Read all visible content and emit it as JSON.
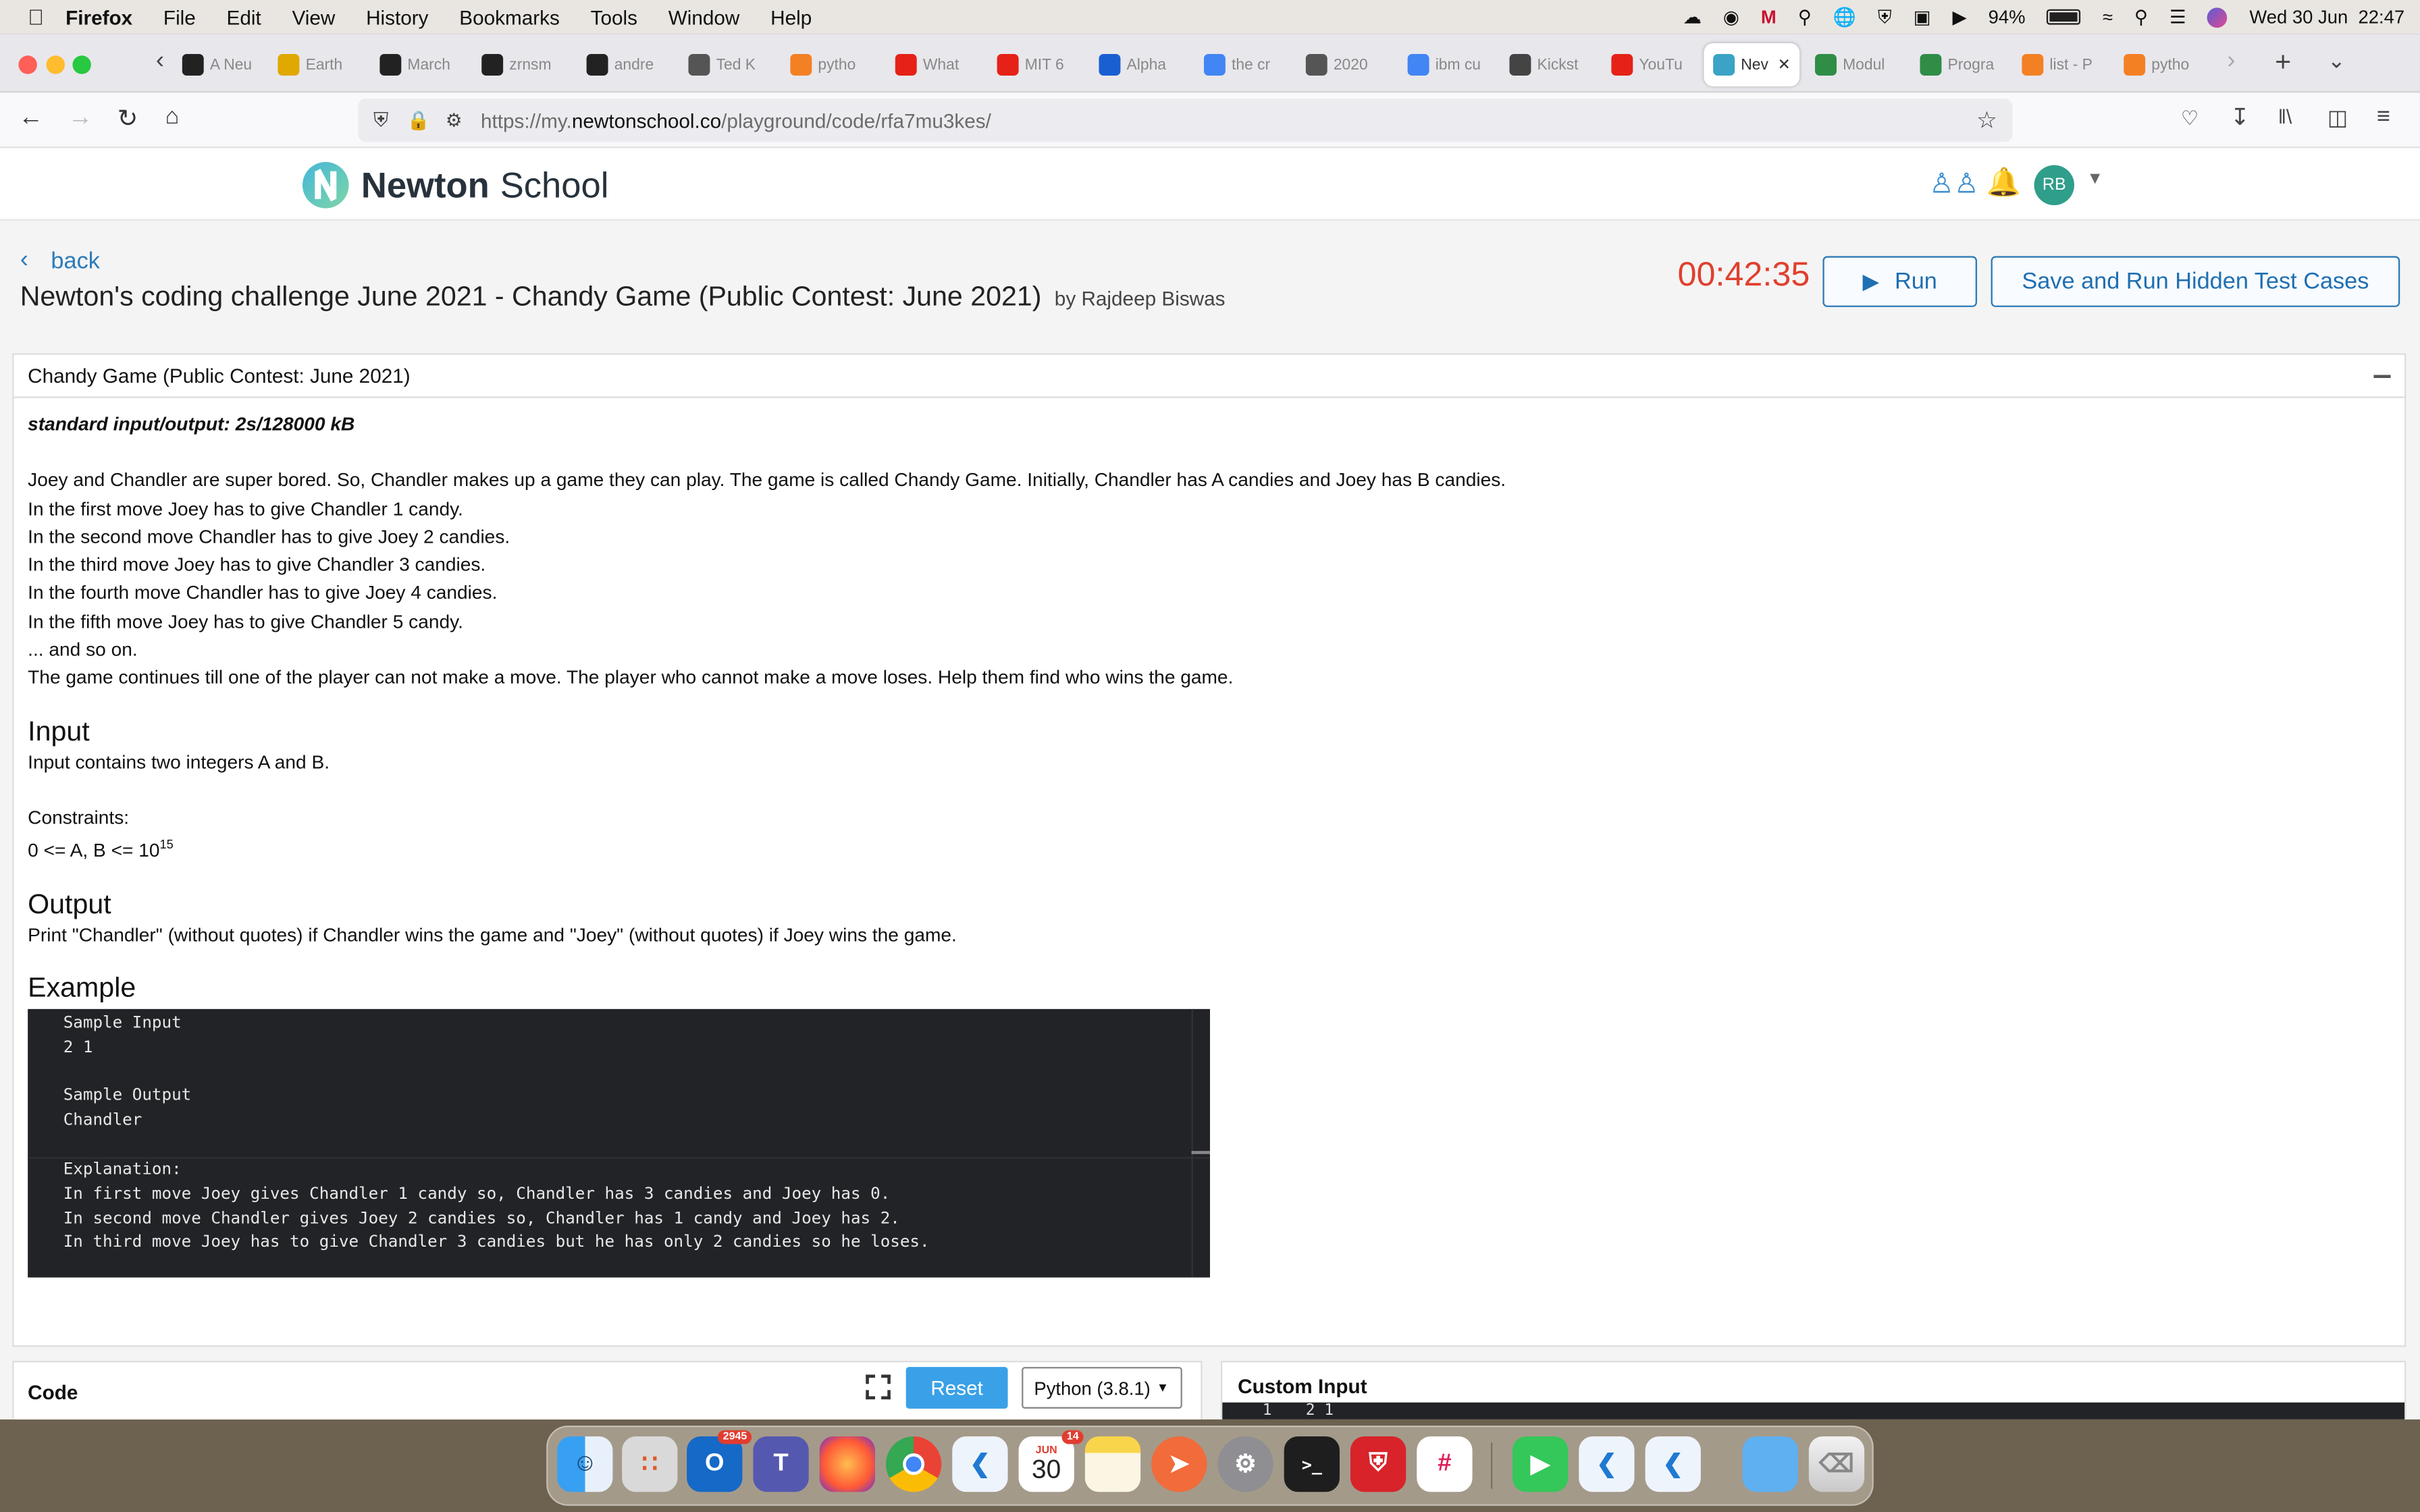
{
  "menubar": {
    "app": "Firefox",
    "items": [
      "File",
      "Edit",
      "View",
      "History",
      "Bookmarks",
      "Tools",
      "Window",
      "Help"
    ],
    "battery": "94%",
    "datetime": "Wed 30 Jun  22:47"
  },
  "tabs": [
    {
      "label": "A Neu",
      "color": "#222"
    },
    {
      "label": "Earth",
      "color": "#e0a800"
    },
    {
      "label": "March",
      "color": "#222"
    },
    {
      "label": "zrnsm",
      "color": "#222"
    },
    {
      "label": "andre",
      "color": "#222"
    },
    {
      "label": "Ted K",
      "color": "#555"
    },
    {
      "label": "pytho",
      "color": "#f48024"
    },
    {
      "label": "What",
      "color": "#e62117"
    },
    {
      "label": "MIT 6",
      "color": "#e62117"
    },
    {
      "label": "Alpha",
      "color": "#1a5fd1"
    },
    {
      "label": "the cr",
      "color": "#4285f4"
    },
    {
      "label": "2020",
      "color": "#555"
    },
    {
      "label": "ibm cu",
      "color": "#4285f4"
    },
    {
      "label": "Kickst",
      "color": "#444"
    },
    {
      "label": "YouTu",
      "color": "#e62117"
    },
    {
      "label": "Nev",
      "color": "#3ba3c5"
    },
    {
      "label": "Modul",
      "color": "#2f8d46"
    },
    {
      "label": "Progra",
      "color": "#2f8d46"
    },
    {
      "label": "list - P",
      "color": "#f48024"
    },
    {
      "label": "pytho",
      "color": "#f48024"
    }
  ],
  "url": {
    "prefix": "https://my.",
    "domain": "newtonschool.co",
    "path": "/playground/code/rfa7mu3kes/"
  },
  "site": {
    "brand_bold": "Newton",
    "brand_light": "School",
    "avatar": "RB"
  },
  "problem_header": {
    "back": "back",
    "title": "Newton's coding challenge June 2021 - Chandy Game (Public Contest: June 2021)",
    "by": "by Rajdeep Biswas",
    "timer": "00:42:35",
    "run": "Run",
    "save_run": "Save and Run Hidden Test Cases"
  },
  "panel": {
    "title": "Chandy Game (Public Contest: June 2021)",
    "io": "standard input/output: 2s/128000 kB",
    "statement": [
      "Joey and Chandler are super bored. So, Chandler makes up a game they can play. The game is called Chandy Game. Initially, Chandler has A candies and Joey has B candies.",
      "In the first move Joey has to give Chandler 1 candy.",
      "In the second move Chandler has to give Joey 2 candies.",
      "In the third move Joey has to give Chandler 3 candies.",
      "In the fourth move Chandler has to give Joey 4 candies.",
      "In the fifth move Joey has to give Chandler 5 candy.",
      "... and so on.",
      "The game continues till one of the player can not make a move. The player who cannot make a move loses. Help them find who wins the game."
    ],
    "input_heading": "Input",
    "input_text": "Input contains two integers A and B.",
    "constraints_label": "Constraints:",
    "constraints": "0 <= A, B <= 10",
    "constraints_exp": "15",
    "output_heading": "Output",
    "output_text": "Print \"Chandler\" (without quotes) if Chandler wins the game and \"Joey\" (without quotes) if Joey wins the game.",
    "example_heading": "Example",
    "example_lines": [
      "Sample Input",
      "2 1",
      "",
      "Sample Output",
      "Chandler",
      "",
      "Explanation:",
      "In first move Joey gives Chandler 1 candy so, Chandler has 3 candies and Joey has 0.",
      "In second move Chandler gives Joey 2 candies so, Chandler has 1 candy and Joey has 2.",
      "In third move Joey has to give Chandler 3 candies but he has only 2 candies so he loses."
    ]
  },
  "code_panel": {
    "title": "Code",
    "reset": "Reset",
    "language": "Python (3.8.1)"
  },
  "custom_panel": {
    "title": "Custom Input",
    "line_no": "1",
    "line": "2 1"
  },
  "dock": {
    "outlook_badge": "2945",
    "teams_badge": "",
    "calendar_month": "JUN",
    "calendar_day": "30",
    "calendar_badge": "14"
  }
}
